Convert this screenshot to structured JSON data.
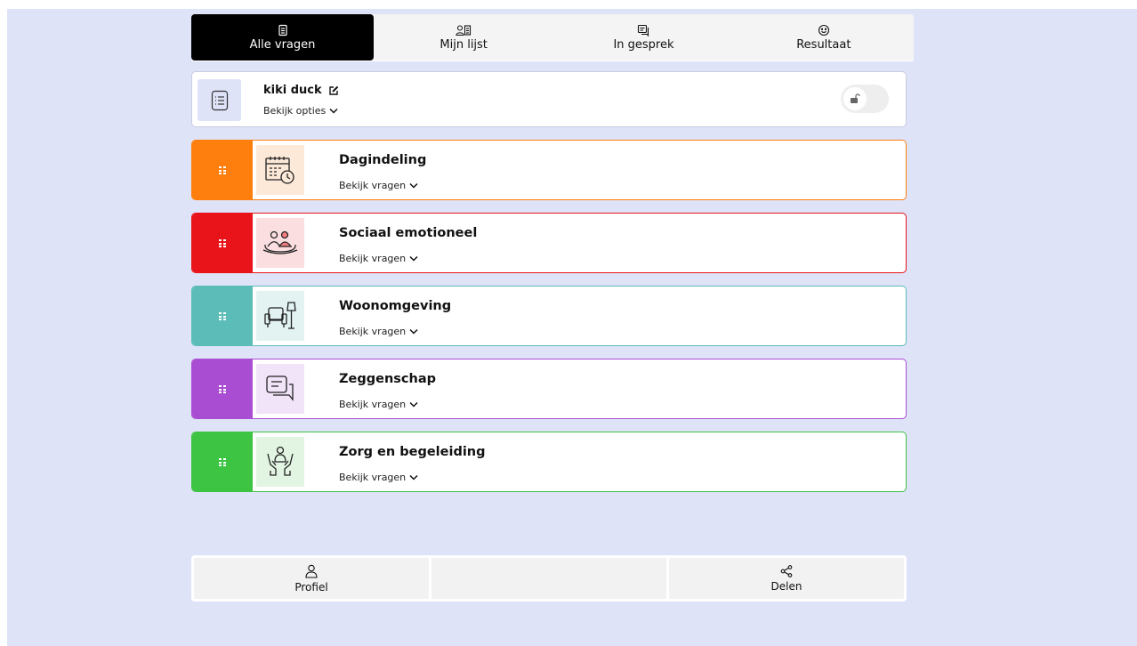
{
  "tabs": [
    {
      "label": "Alle vragen",
      "icon": "document-icon",
      "active": true
    },
    {
      "label": "Mijn lijst",
      "icon": "user-list-icon",
      "active": false
    },
    {
      "label": "In gesprek",
      "icon": "chat-icon",
      "active": false
    },
    {
      "label": "Resultaat",
      "icon": "smiley-icon",
      "active": false
    }
  ],
  "profile": {
    "name": "kiki duck",
    "options_label": "Bekijk opties",
    "icon": "list-icon",
    "lock_icon": "unlock-icon"
  },
  "categories": [
    {
      "title": "Dagindeling",
      "sub": "Bekijk vragen",
      "color": "#ff7f0e",
      "bg": "#fde9d8",
      "icon": "calendar-clock-icon"
    },
    {
      "title": "Sociaal emotioneel",
      "sub": "Bekijk vragen",
      "color": "#e8141a",
      "bg": "#fbdedf",
      "icon": "people-icon"
    },
    {
      "title": "Woonomgeving",
      "sub": "Bekijk vragen",
      "color": "#5cbcb8",
      "bg": "#e2f3f2",
      "icon": "armchair-lamp-icon"
    },
    {
      "title": "Zeggenschap",
      "sub": "Bekijk vragen",
      "color": "#a94ed3",
      "bg": "#f1e3f8",
      "icon": "speech-bubbles-icon"
    },
    {
      "title": "Zorg en begeleiding",
      "sub": "Bekijk vragen",
      "color": "#3cc442",
      "bg": "#e2f4e2",
      "icon": "caring-hands-icon"
    }
  ],
  "bottom": {
    "profile_label": "Profiel",
    "share_label": "Delen"
  }
}
